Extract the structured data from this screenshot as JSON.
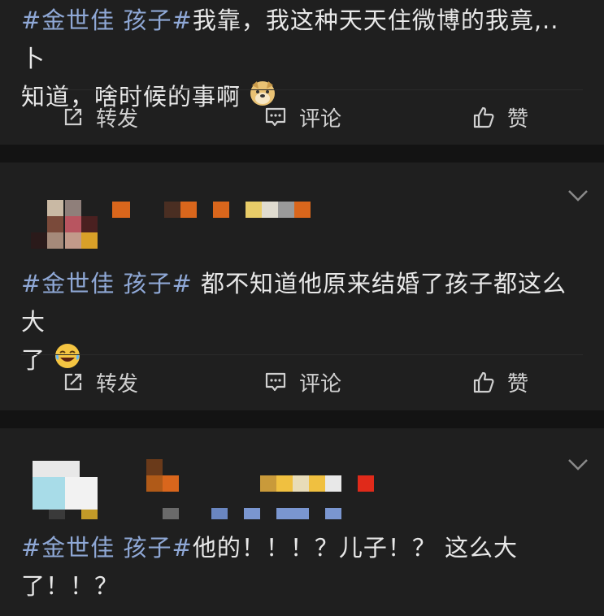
{
  "posts": [
    {
      "tag": "#金世佳 孩子#",
      "text_line1": "我靠，我这种天天住微博的我竟,.. 卜",
      "text_line2": "知道，啥时候的事啊",
      "emoji": "doge-emoji"
    },
    {
      "tag": "#金世佳 孩子#",
      "text_line1": " 都不知道他原来结婚了孩子都这么大",
      "text_line2": "了",
      "emoji": "laughing-tears-emoji"
    },
    {
      "tag": "#金世佳 孩子#",
      "text_line1": "他的！！！？儿子！？ 这么大",
      "text_line2": "了！！？"
    }
  ],
  "actions": {
    "repost": "转发",
    "comment": "评论",
    "like": "赞"
  },
  "colors": {
    "background": "#1f1f1f",
    "separator": "#131313",
    "hashtag": "#8fa8d6",
    "text": "#e8e8e8"
  }
}
